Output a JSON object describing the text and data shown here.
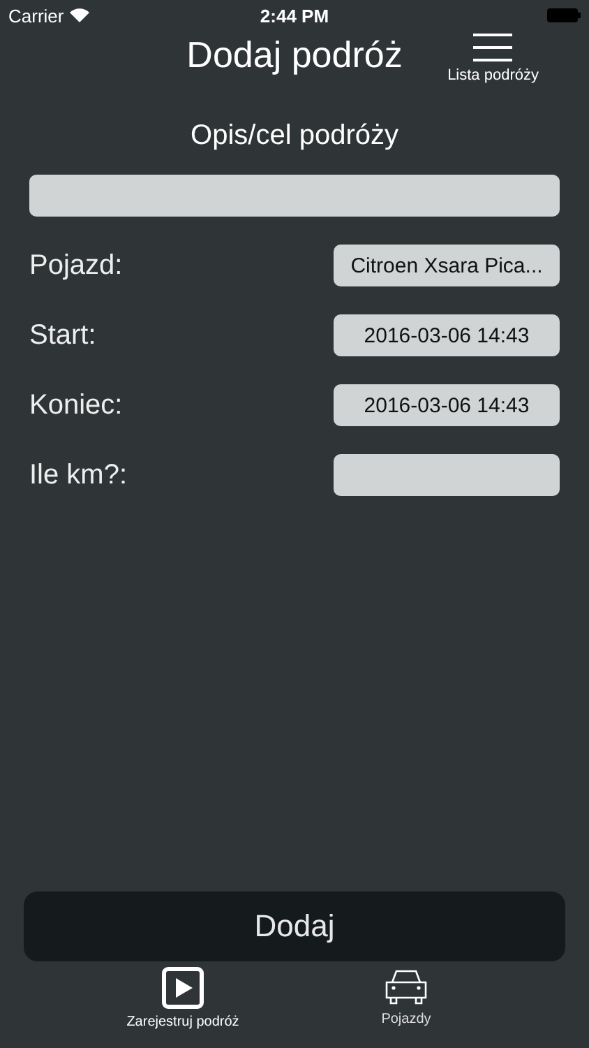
{
  "status_bar": {
    "carrier": "Carrier",
    "time": "2:44 PM"
  },
  "nav": {
    "title": "Dodaj podróż",
    "menu_label": "Lista podróży"
  },
  "description": {
    "label": "Opis/cel podróży"
  },
  "rows": [
    {
      "label": "Pojazd:",
      "value": "Citroen Xsara Pica..."
    },
    {
      "label": "Start:",
      "value": "2016-03-06 14:43"
    },
    {
      "label": "Koniec:",
      "value": "2016-03-06 14:43"
    },
    {
      "label": "Ile km?:"
    }
  ],
  "submit": "Dodaj",
  "tabs": [
    {
      "kind": "play",
      "label": "Zarejestruj podróż",
      "selected": true
    },
    {
      "kind": "car",
      "label": "Pojazdy",
      "selected": false
    }
  ]
}
